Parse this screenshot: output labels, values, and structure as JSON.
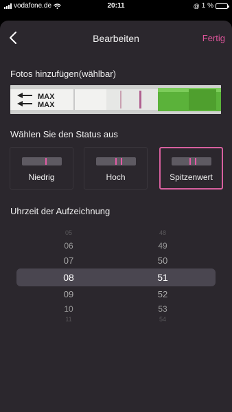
{
  "status_bar": {
    "carrier": "vodafone.de",
    "time": "20:11",
    "battery": "1 %"
  },
  "nav": {
    "title": "Bearbeiten",
    "done_label": "Fertig"
  },
  "photo_section": {
    "label": "Fotos hinzufügen(wählbar)",
    "strip_text_1": "MAX",
    "strip_text_2": "MAX"
  },
  "status_section": {
    "label": "Wählen Sie den Status aus",
    "options": [
      {
        "label": "Niedrig"
      },
      {
        "label": "Hoch"
      },
      {
        "label": "Spitzenwert",
        "selected": true
      }
    ]
  },
  "time_section": {
    "label": "Uhrzeit der Aufzeichnung",
    "hours": [
      "05",
      "06",
      "07",
      "08",
      "09",
      "10",
      "11"
    ],
    "minutes": [
      "48",
      "49",
      "50",
      "51",
      "52",
      "53",
      "54"
    ],
    "selected_hour": "08",
    "selected_minute": "51"
  },
  "colors": {
    "accent": "#e0559c",
    "sheet_bg": "#2b272d"
  }
}
